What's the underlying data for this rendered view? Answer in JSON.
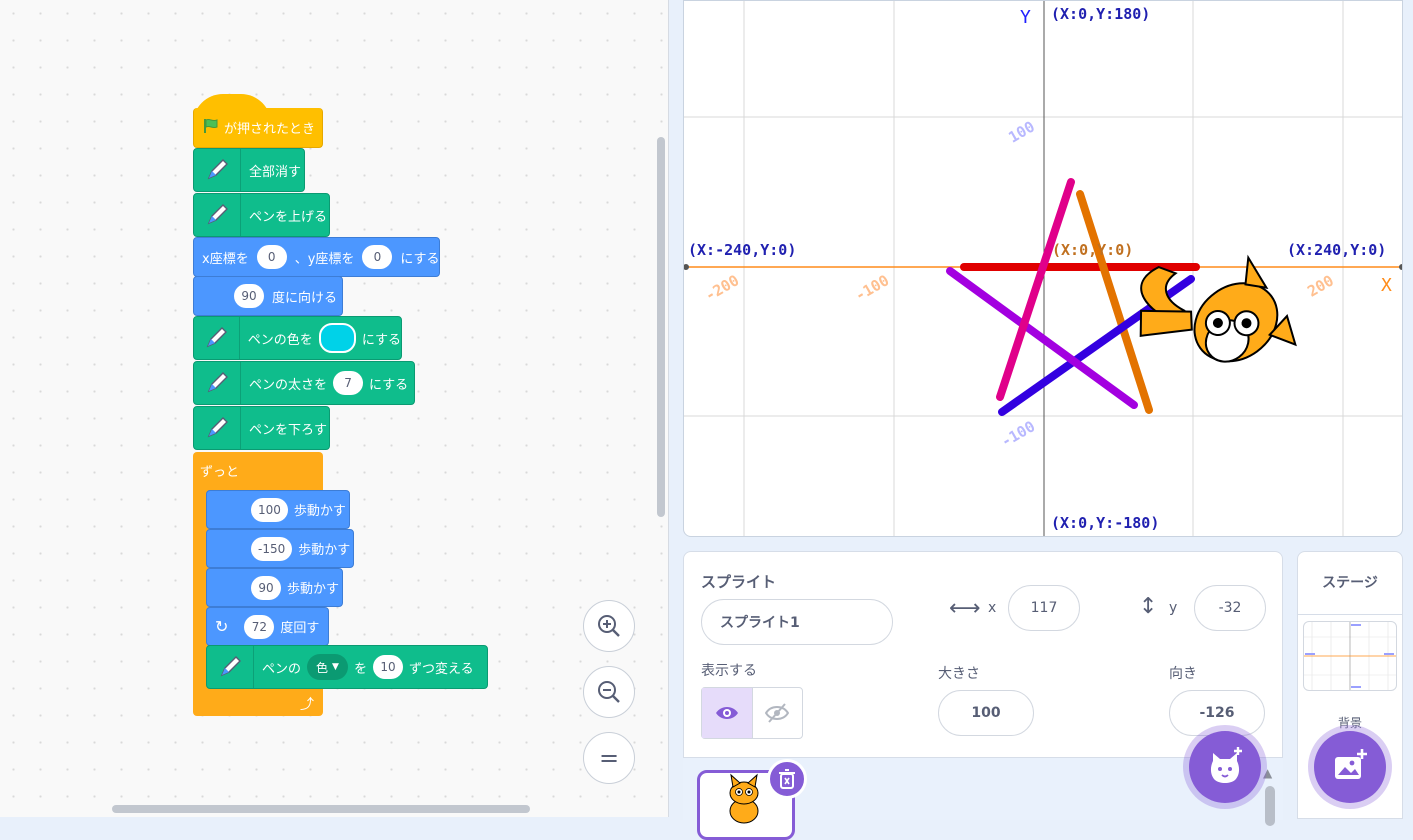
{
  "blocks": {
    "when_flag": "が押されたとき",
    "erase_all": "全部消す",
    "pen_up": "ペンを上げる",
    "goto_x_prefix": "x座標を",
    "goto_x_value": "0",
    "goto_sep": "、y座標を",
    "goto_y_value": "0",
    "goto_suffix": "にする",
    "point_value": "90",
    "point_label": "度に向ける",
    "set_color_prefix": "ペンの色を",
    "set_color_suffix": "にする",
    "set_size_prefix": "ペンの太さを",
    "set_size_value": "7",
    "set_size_suffix": "にする",
    "pen_down": "ペンを下ろす",
    "forever": "ずっと",
    "move1_value": "100",
    "move1_label": "歩動かす",
    "move2_value": "-150",
    "move2_label": "歩動かす",
    "move3_value": "90",
    "move3_label": "歩動かす",
    "turn_value": "72",
    "turn_label": "度回す",
    "change_prefix": "ペンの",
    "change_param": "色",
    "change_mid": "を",
    "change_value": "10",
    "change_suffix": "ずつ変える"
  },
  "stage": {
    "y_axis_label": "Y",
    "x_axis_label": "X",
    "top_coord": "(X:0,Y:180)",
    "bottom_coord": "(X:0,Y:-180)",
    "left_coord": "(X:-240,Y:0)",
    "right_coord": "(X:240,Y:0)",
    "center_coord": "(X:0,Y:0)",
    "tick_x_neg200": "-200",
    "tick_x_neg100": "-100",
    "tick_x_200": "200",
    "tick_y_100": "100",
    "tick_y_neg100": "-100"
  },
  "sprite_info": {
    "sprite_label": "スプライト",
    "sprite_name": "スプライト1",
    "x_label": "x",
    "x_value": "117",
    "y_label": "y",
    "y_value": "-32",
    "show_label": "表示する",
    "size_label": "大きさ",
    "size_value": "100",
    "direction_label": "向き",
    "direction_value": "-126"
  },
  "stage_pane": {
    "title": "ステージ",
    "backdrop_label": "背景"
  },
  "colors": {
    "accent": "#855cd6",
    "motion": "#4c97ff",
    "pen": "#0fbd8c",
    "event": "#ffbf00",
    "control": "#ffab19",
    "pen_color_swatch": "#00d2e8"
  },
  "icons": [
    "flag-icon",
    "pen-icon",
    "rotate-right-icon",
    "zoom-in-icon",
    "zoom-out-icon",
    "zoom-reset-icon",
    "eye-icon",
    "eye-off-icon",
    "x-arrows-icon",
    "y-arrows-icon",
    "trash-icon",
    "add-sprite-icon",
    "add-backdrop-icon"
  ]
}
